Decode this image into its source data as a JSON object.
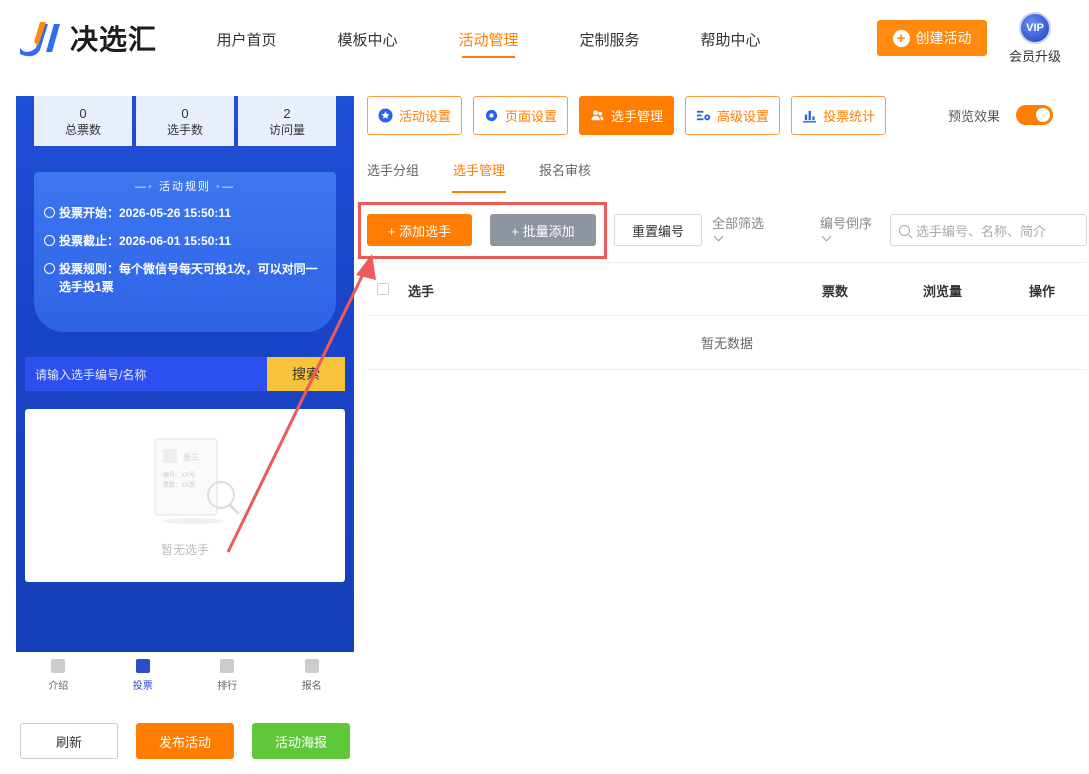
{
  "header": {
    "logo_text": "决选汇",
    "nav": [
      "用户首页",
      "模板中心",
      "活动管理",
      "定制服务",
      "帮助中心"
    ],
    "create_label": "创建活动",
    "vip_badge": "VIP",
    "vip_label": "会员升级"
  },
  "preview": {
    "stats": [
      {
        "num": "0",
        "label": "总票数"
      },
      {
        "num": "0",
        "label": "选手数"
      },
      {
        "num": "2",
        "label": "访问量"
      }
    ],
    "rules_title": "—◦ 活动规则 ◦—",
    "rules": [
      "投票开始：2026-05-26 15:50:11",
      "投票截止：2026-06-01 15:50:11",
      "投票规则：每个微信号每天可投1次，可以对同一选手投1票"
    ],
    "search_placeholder": "请输入选手编号/名称",
    "search_btn": "搜索",
    "empty_card_name": "张三",
    "empty_card_line1": "编号：XX号",
    "empty_card_line2": "票数：XX票",
    "empty_text": "暂无选手",
    "tabs": [
      "介绍",
      "投票",
      "排行",
      "报名"
    ]
  },
  "bottom": {
    "refresh": "刷新",
    "publish": "发布活动",
    "poster": "活动海报"
  },
  "toolbar": {
    "items": [
      "活动设置",
      "页面设置",
      "选手管理",
      "高级设置",
      "投票统计"
    ],
    "preview_label": "预览效果"
  },
  "subtabs": [
    "选手分组",
    "选手管理",
    "报名审核"
  ],
  "actions": {
    "add": "+ 添加选手",
    "batch": "+ 批量添加",
    "reset": "重置编号",
    "filter": "全部筛选",
    "order": "编号倒序",
    "search_placeholder": "选手编号、名称、简介"
  },
  "table": {
    "headers": [
      "选手",
      "票数",
      "浏览量",
      "操作"
    ],
    "empty": "暂无数据"
  },
  "colors": {
    "accent": "#ff7d00",
    "phone_blue": "#1f4fd6",
    "highlight": "#ee5959",
    "poster_green": "#5fc83a"
  }
}
